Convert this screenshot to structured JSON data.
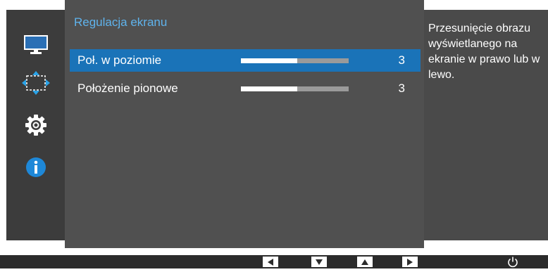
{
  "panel": {
    "title": "Regulacja ekranu",
    "rows": [
      {
        "label": "Poł. w poziomie",
        "value": "3",
        "level": 0.52,
        "selected": true
      },
      {
        "label": "Położenie pionowe",
        "value": "3",
        "level": 0.52,
        "selected": false
      }
    ]
  },
  "info": {
    "text": "Przesunięcie obrazu wyświetlanego na ekranie w prawo lub w lewo."
  },
  "sidebar": {
    "items": [
      {
        "icon": "monitor-icon"
      },
      {
        "icon": "position-arrows-icon"
      },
      {
        "icon": "gear-icon"
      },
      {
        "icon": "info-icon"
      }
    ]
  },
  "bottom_bar": {
    "buttons": [
      {
        "icon": "arrow-left-icon"
      },
      {
        "icon": "arrow-down-icon"
      },
      {
        "icon": "arrow-up-icon"
      },
      {
        "icon": "arrow-right-icon"
      },
      {
        "icon": "power-icon"
      }
    ]
  },
  "colors": {
    "accent": "#1a73b8",
    "title": "#5fb3ec",
    "info_icon": "#1e88d8"
  }
}
